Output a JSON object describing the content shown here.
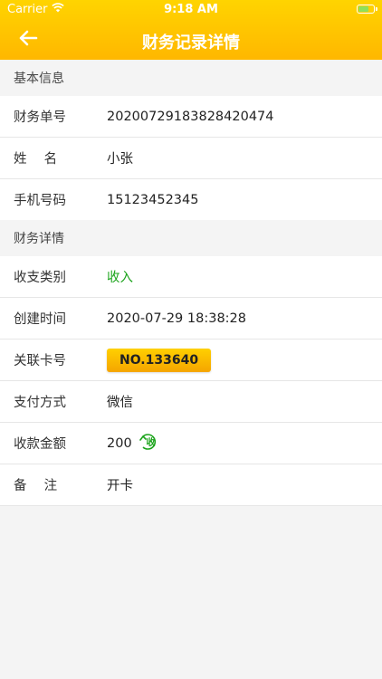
{
  "status_bar": {
    "carrier": "Carrier",
    "time": "9:18 AM"
  },
  "nav": {
    "title": "财务记录详情"
  },
  "basic_info": {
    "section_title": "基本信息",
    "rows": [
      {
        "label": "财务单号",
        "value": "20200729183828420474"
      },
      {
        "label": "姓　 名",
        "value": "小张"
      },
      {
        "label": "手机号码",
        "value": "15123452345"
      }
    ]
  },
  "finance_detail": {
    "section_title": "财务详情",
    "type": {
      "label": "收支类别",
      "value": "收入"
    },
    "created": {
      "label": "创建时间",
      "value": "2020-07-29 18:38:28"
    },
    "card": {
      "label": "关联卡号",
      "value": "NO.133640"
    },
    "payment": {
      "label": "支付方式",
      "value": "微信"
    },
    "amount": {
      "label": "收款金额",
      "value": "200",
      "badge": "收"
    },
    "remark": {
      "label": "备　 注",
      "value": "开卡"
    }
  },
  "colors": {
    "accent": "#ffc400",
    "income": "#1aa31a"
  }
}
